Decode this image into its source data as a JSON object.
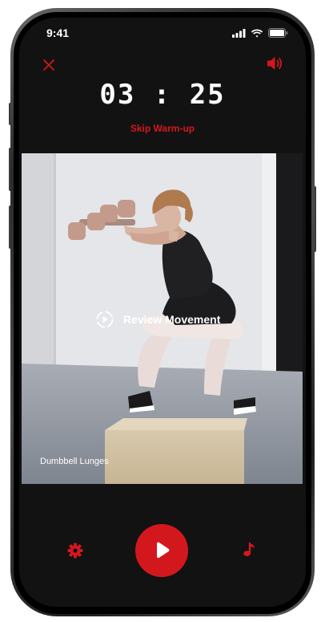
{
  "status_bar": {
    "time": "9:41",
    "icons": [
      "signal-icon",
      "wifi-icon",
      "battery-icon"
    ]
  },
  "header": {
    "close_icon": "close-icon",
    "sound_icon": "speaker-icon"
  },
  "timer": {
    "display": "03 : 25"
  },
  "skip_label": "Skip Warm-up",
  "video": {
    "review_label": "Review Movement",
    "review_icon": "play-circle-icon",
    "caption": "Dumbbell Lunges"
  },
  "controls": {
    "settings_icon": "gear-icon",
    "play_icon": "play-icon",
    "music_icon": "music-note-icon"
  },
  "colors": {
    "accent": "#d2181d",
    "background": "#121212",
    "text": "#ffffff"
  }
}
